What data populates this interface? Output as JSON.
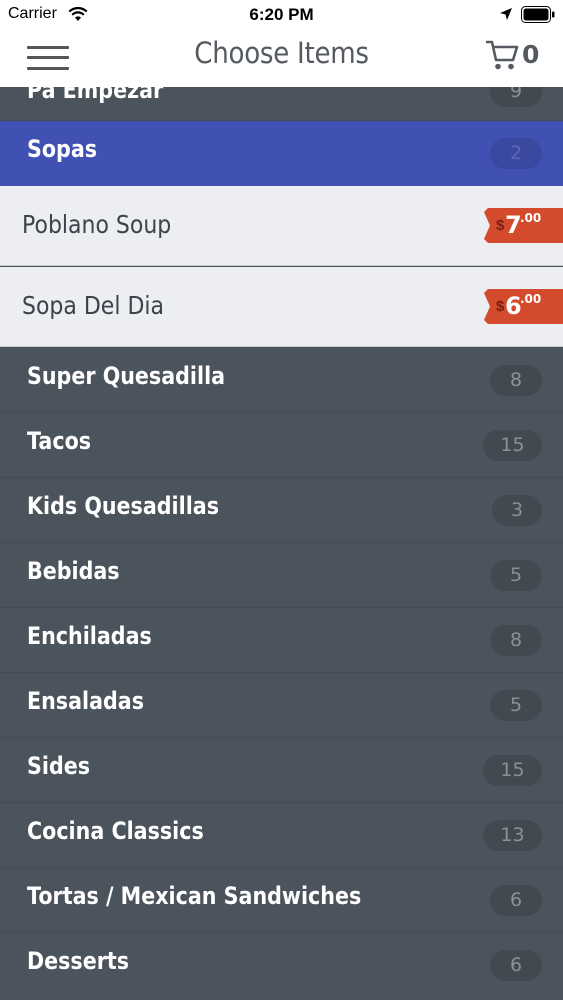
{
  "status_bar": {
    "carrier": "Carrier",
    "time": "6:20 PM",
    "icons": [
      "wifi-icon",
      "location-arrow-icon",
      "battery-icon"
    ]
  },
  "navbar": {
    "title": "Choose Items",
    "cart_count": "0",
    "icons": [
      "hamburger-menu-icon",
      "shopping-cart-icon"
    ]
  },
  "categories_top": {
    "partial": {
      "label": "Pa Empezar",
      "count": "9"
    },
    "active": {
      "label": "Sopas",
      "count": "2"
    }
  },
  "items": [
    {
      "name": "Poblano Soup",
      "currency": "$",
      "price": "7",
      "cents": ".00"
    },
    {
      "name": "Sopa Del Dia",
      "currency": "$",
      "price": "6",
      "cents": ".00"
    }
  ],
  "categories": [
    {
      "label": "Super Quesadilla",
      "count": "8"
    },
    {
      "label": "Tacos",
      "count": "15"
    },
    {
      "label": "Kids Quesadillas",
      "count": "3"
    },
    {
      "label": "Bebidas",
      "count": "5"
    },
    {
      "label": "Enchiladas",
      "count": "8"
    },
    {
      "label": "Ensaladas",
      "count": "5"
    },
    {
      "label": "Sides",
      "count": "15"
    },
    {
      "label": "Cocina Classics",
      "count": "13"
    },
    {
      "label": "Tortas / Mexican Sandwiches",
      "count": "6"
    },
    {
      "label": "Desserts",
      "count": "6"
    }
  ],
  "colors": {
    "active_category": "#4150b3",
    "price_tag": "#d44a2c",
    "list_background": "#4b535c"
  }
}
